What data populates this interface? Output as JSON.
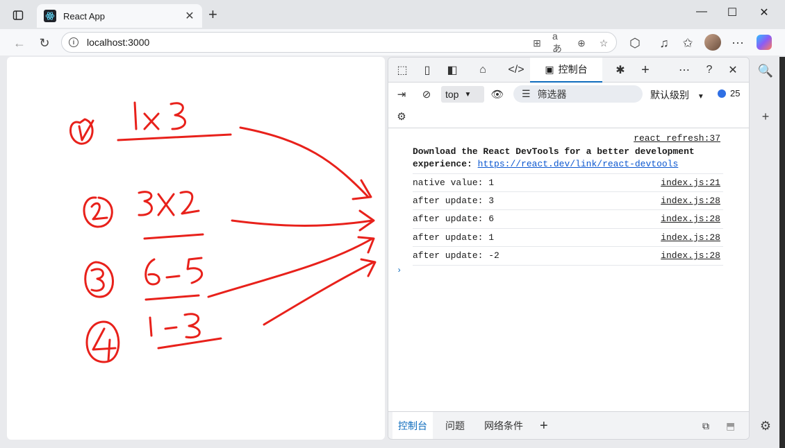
{
  "browser": {
    "tab_title": "React App",
    "address": "localhost:3000",
    "window_controls": [
      "minimize-icon",
      "maximize-icon",
      "close-icon"
    ]
  },
  "devtools": {
    "active_tab_label": "控制台",
    "context_label": "top",
    "filter_placeholder": "筛选器",
    "levels_label": "默认级别",
    "issues_count": "25",
    "react_notice": {
      "source": "react_refresh:37",
      "message": "Download the React DevTools for a better development experience:",
      "link": "https://react.dev/link/react-devtools"
    },
    "logs": [
      {
        "message": "native value: 1",
        "source": "index.js:21"
      },
      {
        "message": "after update: 3",
        "source": "index.js:28"
      },
      {
        "message": "after update: 6",
        "source": "index.js:28"
      },
      {
        "message": "after update: 1",
        "source": "index.js:28"
      },
      {
        "message": "after update: -2",
        "source": "index.js:28"
      }
    ],
    "drawer_tabs": [
      "控制台",
      "问题",
      "网络条件"
    ]
  },
  "annotations": {
    "items": [
      {
        "number": "1",
        "expr": "1x3"
      },
      {
        "number": "2",
        "expr": "3x2"
      },
      {
        "number": "3",
        "expr": "6-5"
      },
      {
        "number": "4",
        "expr": "1-3"
      }
    ],
    "ink_color": "#e8211b"
  }
}
